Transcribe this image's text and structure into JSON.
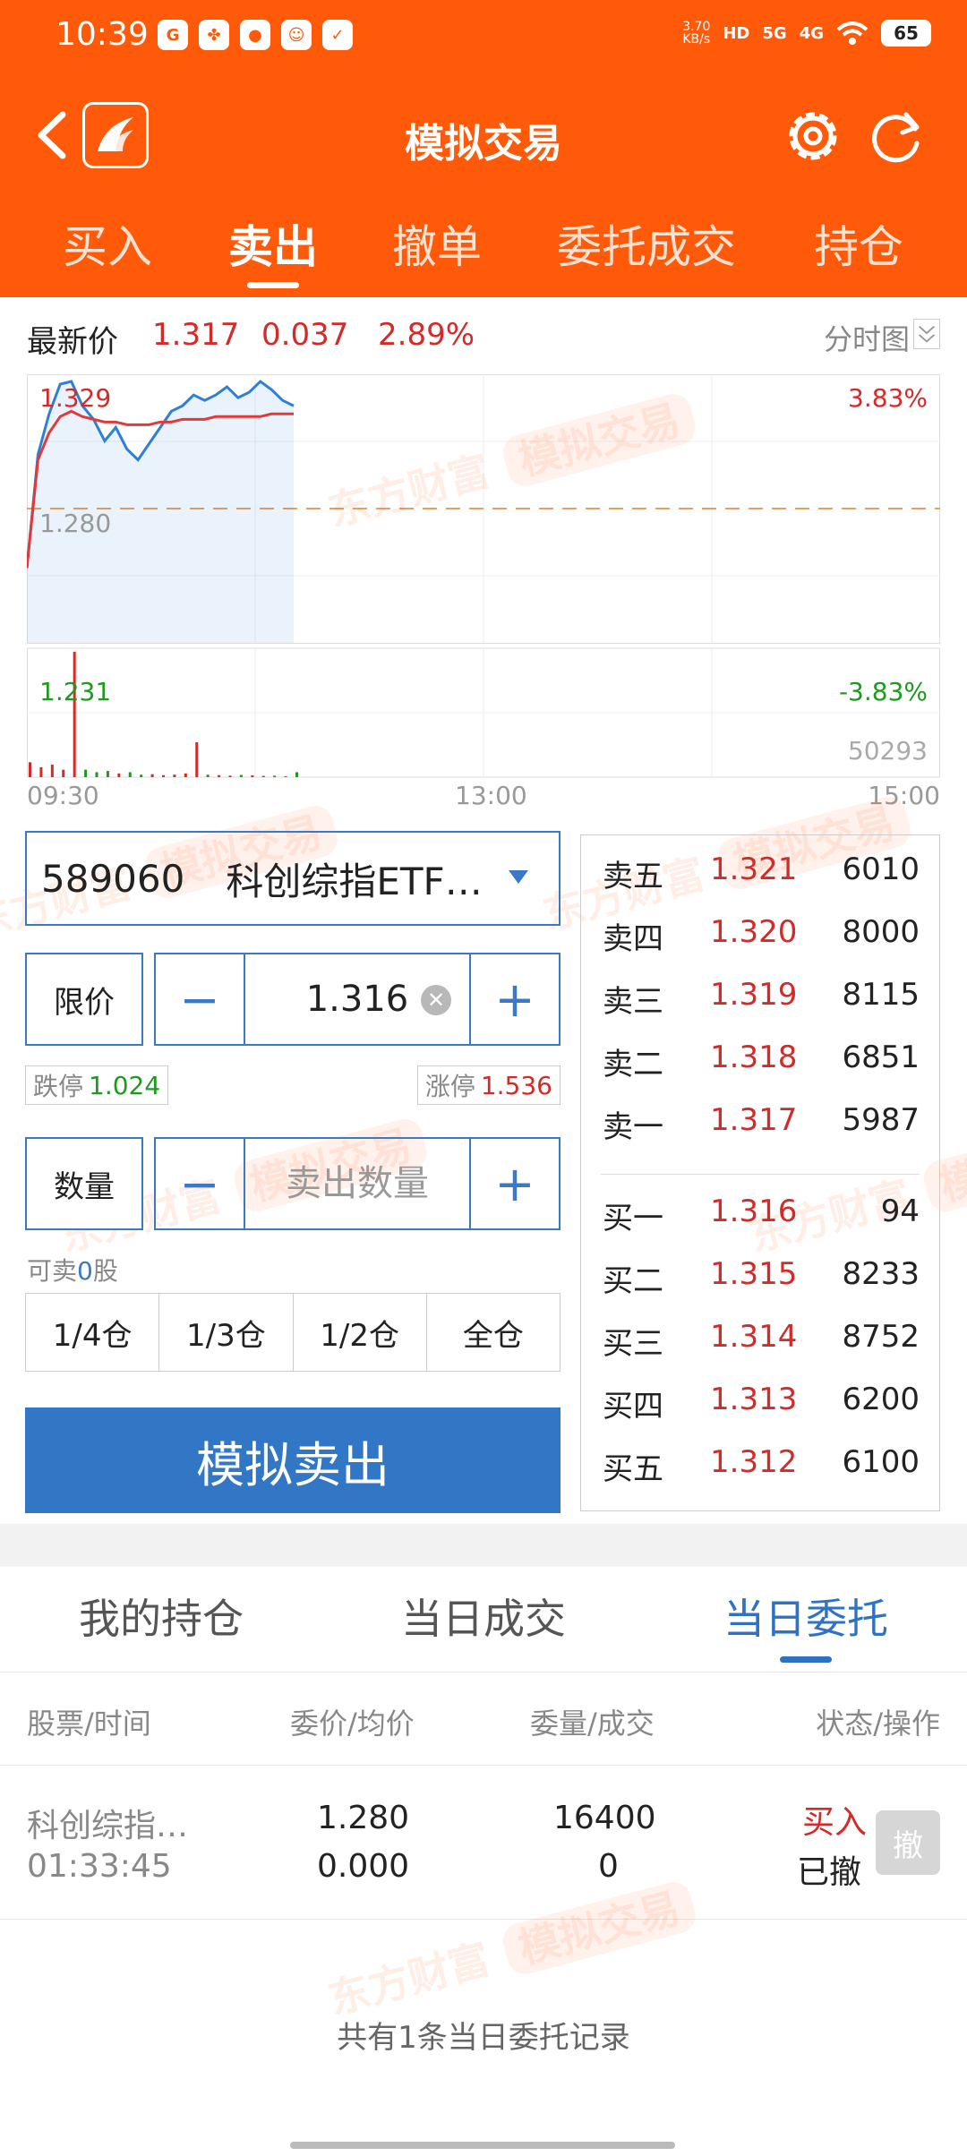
{
  "status_bar": {
    "time": "10:39",
    "network_speed_value": "3.70",
    "network_speed_unit": "KB/s",
    "hd_label": "HD",
    "signal_1": "5G",
    "signal_2": "4G",
    "battery": "65"
  },
  "nav": {
    "title": "模拟交易"
  },
  "top_tabs": [
    {
      "label": "买入"
    },
    {
      "label": "卖出"
    },
    {
      "label": "撤单"
    },
    {
      "label": "委托成交"
    },
    {
      "label": "持仓"
    }
  ],
  "quote": {
    "label": "最新价",
    "price": "1.317",
    "change": "0.037",
    "change_pct": "2.89%",
    "chart_type": "分时图"
  },
  "chart_labels": {
    "high": "1.329",
    "high_pct": "3.83%",
    "base": "1.280",
    "low": "1.231",
    "low_pct": "-3.83%",
    "max_volume": "50293",
    "time_start": "09:30",
    "time_mid": "13:00",
    "time_end": "15:00"
  },
  "chart_data": {
    "type": "line",
    "x_range": [
      "09:30",
      "15:00"
    ],
    "ylim": [
      1.231,
      1.329
    ],
    "base_price": 1.28,
    "series": [
      {
        "values": [
          1.258,
          1.3,
          1.315,
          1.326,
          1.327,
          1.318,
          1.313,
          1.305,
          1.31,
          1.302,
          1.298,
          1.304,
          1.31,
          1.316,
          1.318,
          1.322,
          1.32,
          1.322,
          1.325,
          1.321,
          1.323,
          1.327,
          1.324,
          1.32,
          1.318
        ]
      },
      {
        "values": [
          1.258,
          1.298,
          1.308,
          1.314,
          1.316,
          1.314,
          1.313,
          1.312,
          1.312,
          1.311,
          1.311,
          1.311,
          1.312,
          1.312,
          1.313,
          1.313,
          1.313,
          1.314,
          1.314,
          1.314,
          1.314,
          1.314,
          1.315,
          1.315,
          1.315
        ]
      }
    ],
    "volume": [
      6000,
      4000,
      5000,
      3000,
      50293,
      3000,
      2000,
      2500,
      1500,
      2000,
      1000,
      1200,
      800,
      1000,
      1500,
      14000,
      1000,
      800,
      600,
      900,
      700,
      500,
      600,
      400,
      2000
    ]
  },
  "order_form": {
    "stock_code": "589060",
    "stock_name": "科创综指ETF…",
    "price_type": "限价",
    "price": "1.316",
    "limit_down_label": "跌停",
    "limit_down": "1.024",
    "limit_up_label": "涨停",
    "limit_up": "1.536",
    "qty_type": "数量",
    "qty_placeholder": "卖出数量",
    "sellable_prefix": "可卖",
    "sellable_count": "0",
    "sellable_suffix": "股",
    "positions": [
      "1/4仓",
      "1/3仓",
      "1/2仓",
      "全仓"
    ],
    "submit_label": "模拟卖出",
    "minus": "−",
    "plus": "+"
  },
  "order_book": {
    "asks": [
      {
        "label": "卖五",
        "price": "1.321",
        "volume": "6010"
      },
      {
        "label": "卖四",
        "price": "1.320",
        "volume": "8000"
      },
      {
        "label": "卖三",
        "price": "1.319",
        "volume": "8115"
      },
      {
        "label": "卖二",
        "price": "1.318",
        "volume": "6851"
      },
      {
        "label": "卖一",
        "price": "1.317",
        "volume": "5987"
      }
    ],
    "bids": [
      {
        "label": "买一",
        "price": "1.316",
        "volume": "94"
      },
      {
        "label": "买二",
        "price": "1.315",
        "volume": "8233"
      },
      {
        "label": "买三",
        "price": "1.314",
        "volume": "8752"
      },
      {
        "label": "买四",
        "price": "1.313",
        "volume": "6200"
      },
      {
        "label": "买五",
        "price": "1.312",
        "volume": "6100"
      }
    ]
  },
  "watermark": {
    "brand": "东方财富",
    "tag": "模拟交易"
  },
  "bottom_tabs": [
    {
      "label": "我的持仓"
    },
    {
      "label": "当日成交"
    },
    {
      "label": "当日委托"
    }
  ],
  "orders_table": {
    "headers": [
      "股票/时间",
      "委价/均价",
      "委量/成交",
      "状态/操作"
    ],
    "rows": [
      {
        "name": "科创综指…",
        "time": "01:33:45",
        "price": "1.280",
        "avg_price": "0.000",
        "qty": "16400",
        "filled": "0",
        "side": "买入",
        "status": "已撤",
        "action": "撤"
      }
    ],
    "footer": "共有1条当日委托记录"
  },
  "colors": {
    "brand_orange": "#ff5a0a",
    "accent_blue": "#3276c6",
    "up_red": "#d32a2a",
    "down_green": "#1f9a1f",
    "line_blue": "#2f7fd6",
    "avg_red": "#e03a3a"
  },
  "icons": {
    "back": "chevron-left-icon",
    "logo": "app-logo-icon",
    "settings": "gear-icon",
    "refresh": "refresh-icon",
    "clear": "clear-icon",
    "dropdown": "triangle-down-icon",
    "collapse": "chevron-down-icon"
  }
}
